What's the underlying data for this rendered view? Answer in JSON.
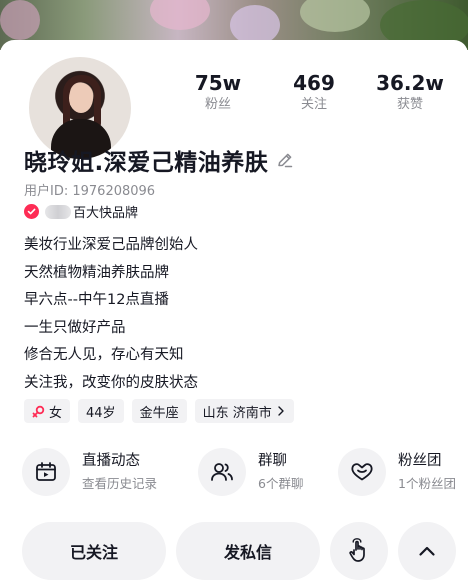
{
  "stats": [
    {
      "value": "75w",
      "label": "粉丝"
    },
    {
      "value": "469",
      "label": "关注"
    },
    {
      "value": "36.2w",
      "label": "获赞"
    }
  ],
  "profile": {
    "nickname": "晓玲姐.深爱己精油养肤",
    "user_id": "用户ID: 1976208096",
    "brand": "百大快品牌"
  },
  "bio": [
    "美妆行业深爱己品牌创始人",
    "天然植物精油养肤品牌",
    "早六点--中午12点直播",
    "一生只做好产品",
    "修合无人见，存心有天知",
    "关注我，改变你的皮肤状态"
  ],
  "tags": {
    "gender": "女",
    "age": "44岁",
    "zodiac": "金牛座",
    "location": "山东 济南市"
  },
  "features": [
    {
      "title": "直播动态",
      "sub": "查看历史记录",
      "icon": "live-history-icon"
    },
    {
      "title": "群聊",
      "sub": "6个群聊",
      "icon": "group-chat-icon"
    },
    {
      "title": "粉丝团",
      "sub": "1个粉丝团",
      "icon": "fan-club-icon"
    }
  ],
  "actions": {
    "followed_label": "已关注",
    "message_label": "发私信"
  },
  "colors": {
    "accent": "#fe2c55",
    "text_primary": "#161823",
    "text_secondary": "#8a8b91",
    "button_bg": "#f2f2f4"
  }
}
